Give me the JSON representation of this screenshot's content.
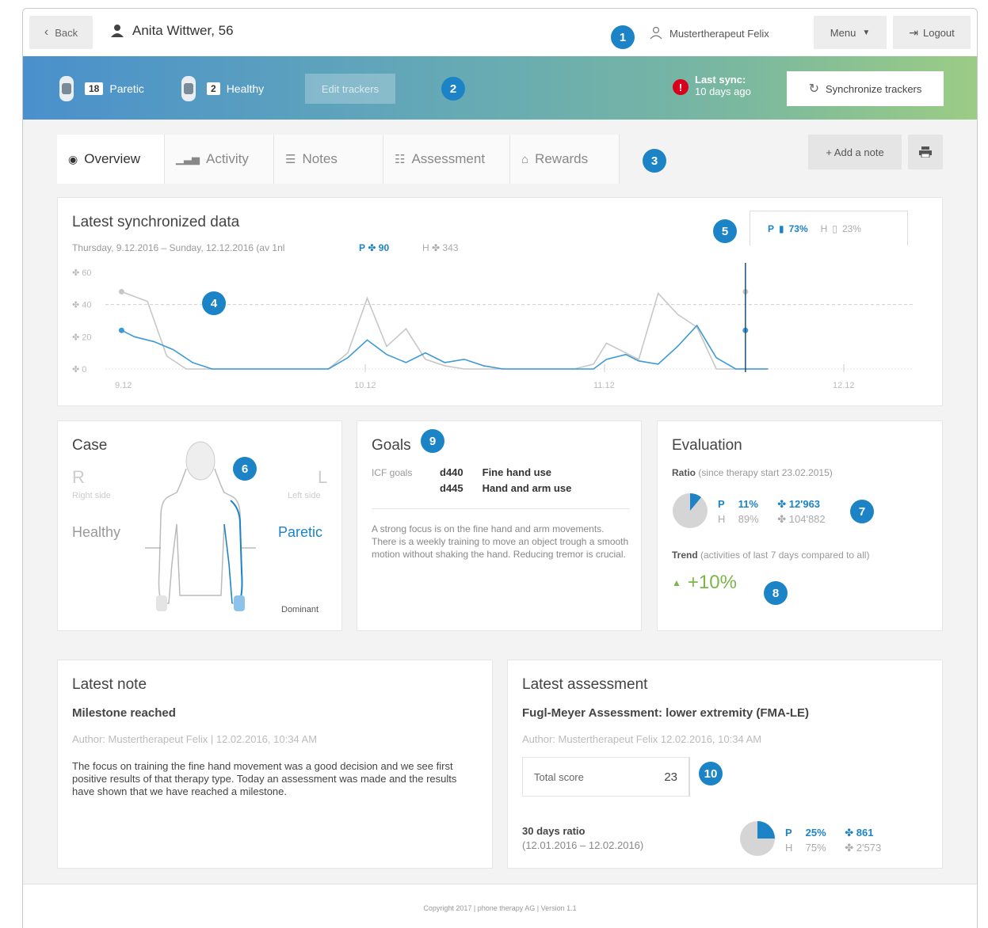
{
  "topbar": {
    "back_label": "Back",
    "patient_name": "Anita Wittwer, 56",
    "therapist": "Mustertherapeut Felix",
    "menu_label": "Menu",
    "logout_label": "Logout"
  },
  "trackers": {
    "paretic_count": "18",
    "paretic_label": "Paretic",
    "healthy_count": "2",
    "healthy_label": "Healthy",
    "edit_label": "Edit trackers",
    "alert_glyph": "!",
    "last_sync_label": "Last sync:",
    "last_sync_value": "10 days ago",
    "sync_button": "Synchronize trackers"
  },
  "tabs": [
    {
      "label": "Overview",
      "icon": "eye-icon"
    },
    {
      "label": "Activity",
      "icon": "bar-chart-icon"
    },
    {
      "label": "Notes",
      "icon": "notes-icon"
    },
    {
      "label": "Assessment",
      "icon": "assessment-icon"
    },
    {
      "label": "Rewards",
      "icon": "trophy-icon"
    }
  ],
  "actions": {
    "add_note": "+ Add a note",
    "print_icon": "print-icon"
  },
  "markers": [
    "1",
    "2",
    "3",
    "4",
    "5",
    "6",
    "7",
    "8",
    "9",
    "10"
  ],
  "latest_data": {
    "title": "Latest synchronized data",
    "date_range": "Thursday, 9.12.2016 – Sunday, 12.12.2016 (av 1nl",
    "p_label": "P",
    "p_value": "90",
    "h_label": "H",
    "h_value": "343",
    "ratio_p_label": "P",
    "ratio_p_value": "73%",
    "ratio_h_label": "H",
    "ratio_h_value": "23%"
  },
  "chart_data": {
    "type": "line",
    "x_ticks": [
      "9.12",
      "10.12",
      "11.12",
      "12.12"
    ],
    "y_ticks": [
      "0",
      "20",
      "40",
      "60"
    ],
    "ylim": [
      0,
      60
    ],
    "xlim": [
      0,
      100
    ],
    "series": [
      {
        "name": "P",
        "color": "#3d9ad6",
        "x": [
          0,
          2,
          5,
          8,
          11,
          14,
          17,
          20,
          24,
          28,
          32,
          35,
          38,
          41,
          44,
          47,
          50,
          53,
          56,
          59,
          62,
          65,
          68,
          70,
          73,
          75,
          78,
          80,
          83,
          86,
          89,
          92,
          95,
          98,
          100
        ],
        "values": [
          24,
          20,
          17,
          12,
          4,
          0,
          0,
          0,
          0,
          0,
          0,
          7,
          18,
          9,
          4,
          10,
          4,
          6,
          2,
          0,
          0,
          0,
          0,
          0,
          0,
          6,
          9,
          5,
          3,
          14,
          27,
          7,
          0,
          0,
          0
        ]
      },
      {
        "name": "H",
        "color": "#c7c7c7",
        "x": [
          0,
          4,
          7,
          10,
          14,
          17,
          20,
          24,
          28,
          32,
          35,
          38,
          41,
          44,
          47,
          50,
          53,
          56,
          59,
          62,
          65,
          68,
          70,
          73,
          75,
          78,
          80,
          83,
          86,
          89,
          92,
          95,
          98,
          100
        ],
        "values": [
          48,
          42,
          8,
          0,
          0,
          0,
          0,
          0,
          0,
          0,
          10,
          44,
          14,
          25,
          6,
          2,
          0,
          0,
          0,
          0,
          0,
          0,
          0,
          3,
          16,
          10,
          6,
          47,
          34,
          26,
          0,
          0,
          0,
          0
        ]
      }
    ]
  },
  "case": {
    "title": "Case",
    "r_label": "R",
    "r_side": "Right side",
    "l_label": "L",
    "l_side": "Left side",
    "healthy": "Healthy",
    "paretic": "Paretic",
    "dominant": "Dominant"
  },
  "goals": {
    "title": "Goals",
    "icf_label": "ICF goals",
    "code1": "d440",
    "goal1": "Fine hand use",
    "code2": "d445",
    "goal2": "Hand and arm use",
    "description": "A strong focus is on the fine hand and arm movements. There is a weekly training to move an object trough a smooth motion without shaking the hand. Reducing tremor is crucial."
  },
  "evaluation": {
    "title": "Evaluation",
    "ratio_label": "Ratio",
    "ratio_note": "(since therapy start 23.02.2015)",
    "p_label": "P",
    "p_pct": "11%",
    "p_count": "12'963",
    "h_label": "H",
    "h_pct": "89%",
    "h_count": "104'882",
    "pie_fraction": 0.11,
    "trend_label": "Trend",
    "trend_note": "(activities of last 7 days compared to all)",
    "trend_value": "+10%"
  },
  "note": {
    "heading": "Latest note",
    "title": "Milestone reached",
    "meta": "Author: Mustertherapeut Felix  |  12.02.2016, 10:34 AM",
    "body": "The focus on training the fine hand movement was a good decision and we see first positive results of that therapy type. Today an assessment was made and the results have shown that we have reached a milestone."
  },
  "assessment": {
    "heading": "Latest assessment",
    "title": "Fugl-Meyer Assessment: lower extremity (FMA-LE)",
    "meta": "Author: Mustertherapeut Felix    12.02.2016, 10:34 AM",
    "score_label": "Total score",
    "score_value": "23",
    "ratio_label": "30 days ratio",
    "ratio_range": "(12.01.2016 – 12.02.2016)",
    "p_label": "P",
    "p_pct": "25%",
    "p_count": "861",
    "h_label": "H",
    "h_pct": "75%",
    "h_count": "2'573",
    "pie_fraction": 0.25
  },
  "footer": "Copyright 2017 | phone therapy AG | Version 1.1",
  "colors": {
    "accent": "#1c84c6",
    "trend": "#7ab648",
    "alert": "#d9001b"
  }
}
